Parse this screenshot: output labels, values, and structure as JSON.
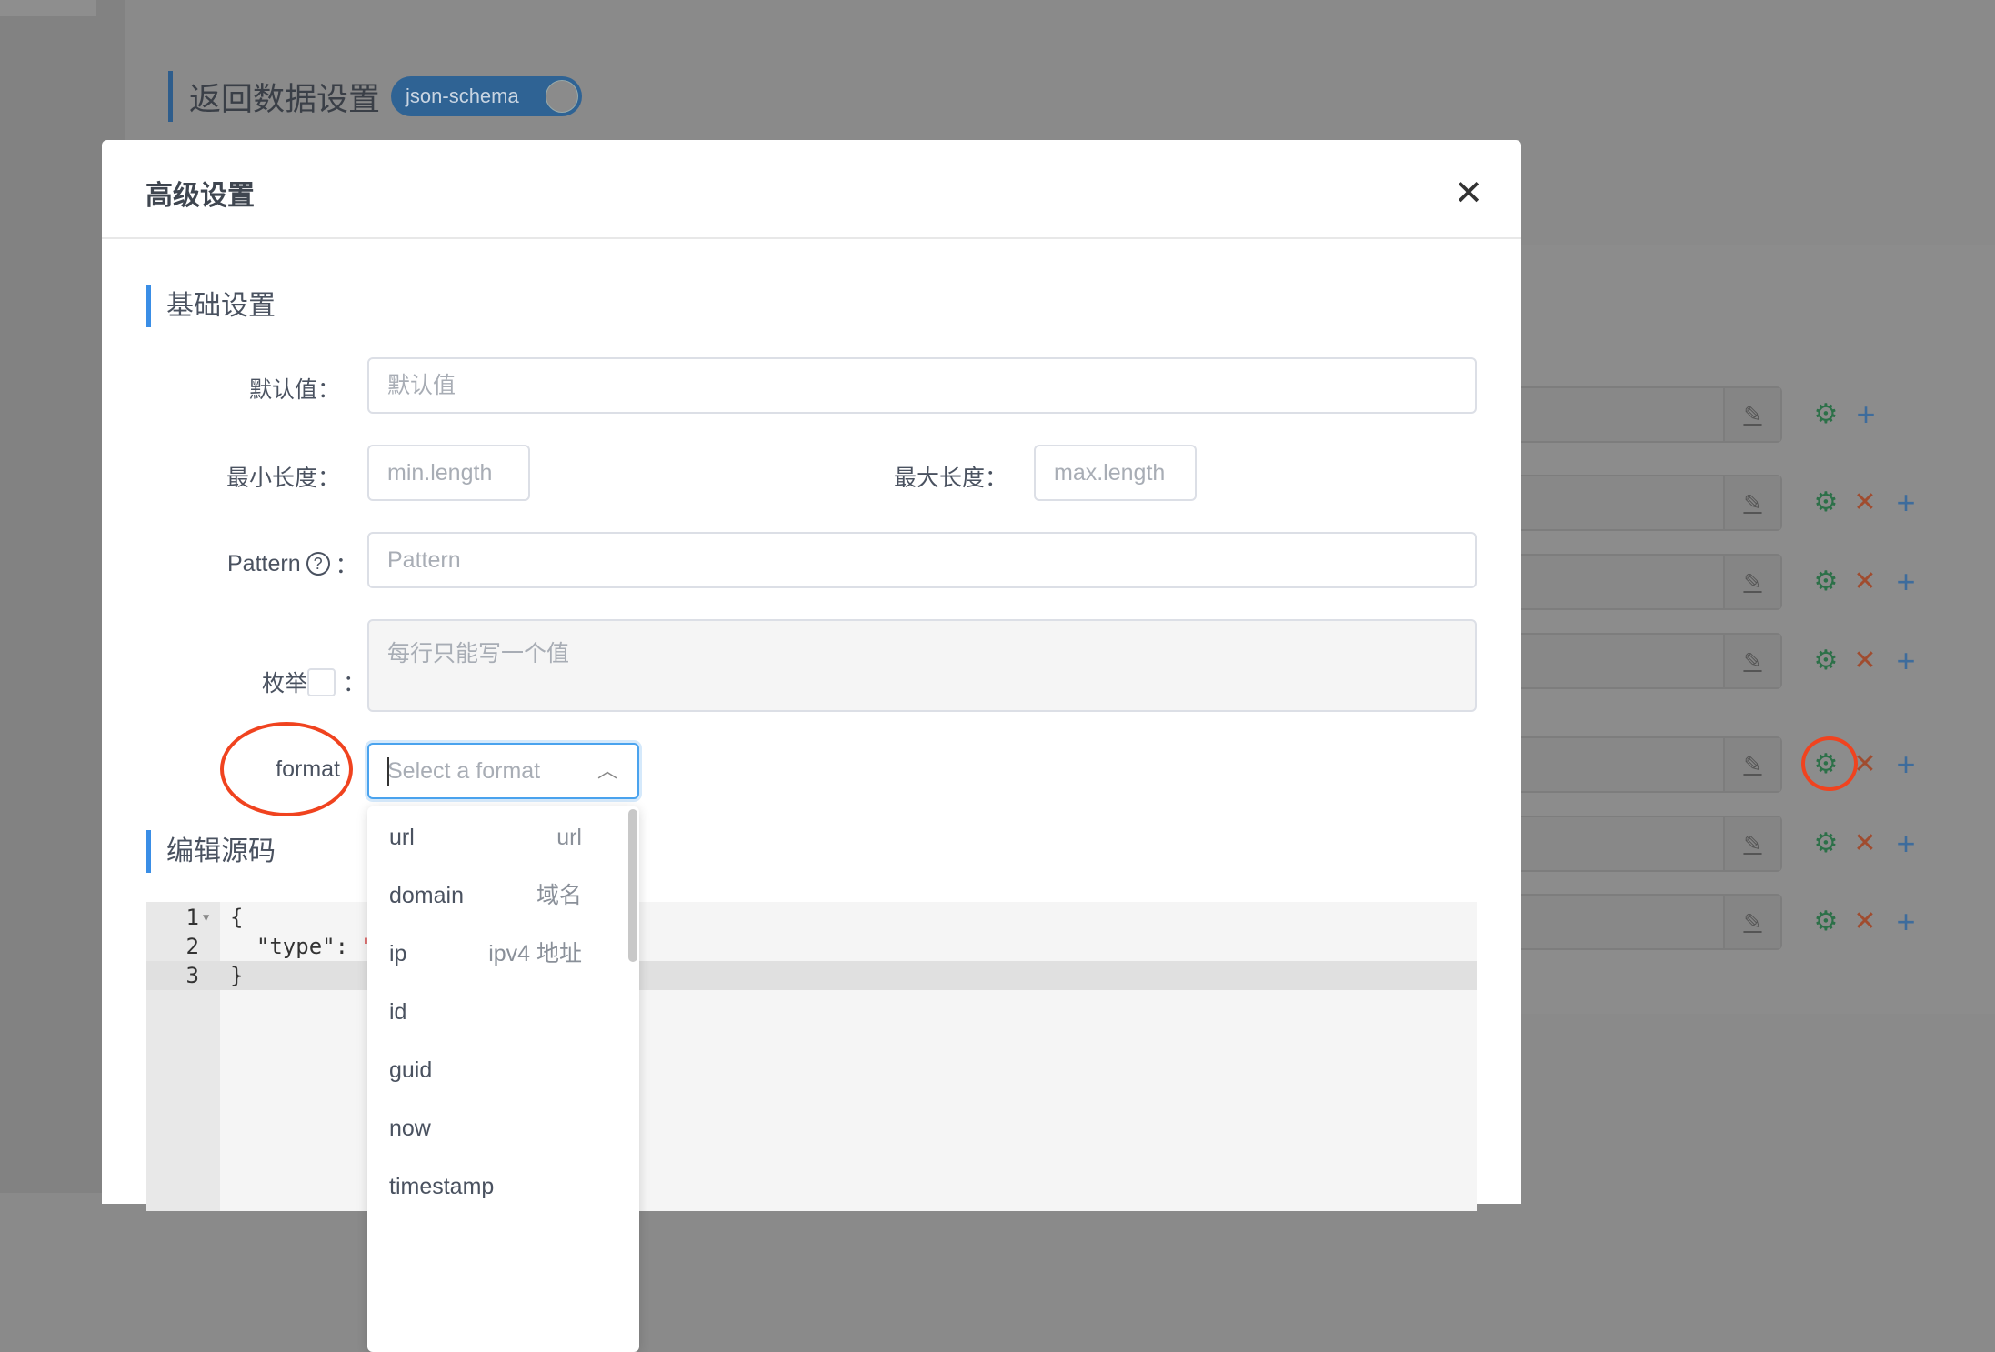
{
  "page": {
    "title": "返回数据设置",
    "toggle_label": "json-schema"
  },
  "modal": {
    "title": "高级设置",
    "close": "✕",
    "basic_section": "基础设置",
    "default_label": "默认值：",
    "default_placeholder": "默认值",
    "min_label": "最小长度：",
    "min_placeholder": "min.length",
    "max_label": "最大长度：",
    "max_placeholder": "max.length",
    "pattern_label": "Pattern",
    "pattern_colon": "：",
    "pattern_placeholder": "Pattern",
    "enum_label": "枚举",
    "enum_colon": "：",
    "enum_placeholder": "每行只能写一个值",
    "format_label": "format",
    "format_placeholder": "Select a format",
    "format_options": [
      {
        "value": "url",
        "desc": "url"
      },
      {
        "value": "domain",
        "desc": "域名"
      },
      {
        "value": "ip",
        "desc": "ipv4 地址"
      },
      {
        "value": "id",
        "desc": ""
      },
      {
        "value": "guid",
        "desc": ""
      },
      {
        "value": "now",
        "desc": ""
      },
      {
        "value": "timestamp",
        "desc": ""
      }
    ],
    "source_section": "编辑源码",
    "code": [
      {
        "n": "1",
        "text": "{"
      },
      {
        "n": "2",
        "text": "  \"type\": ",
        "str": "\""
      },
      {
        "n": "3",
        "text": "}"
      }
    ]
  },
  "colors": {
    "accent": "#3a8ee6",
    "gear": "#2c7048",
    "delete": "#a04c2f",
    "add": "#3e6c9c",
    "annotation": "#f0431f"
  }
}
